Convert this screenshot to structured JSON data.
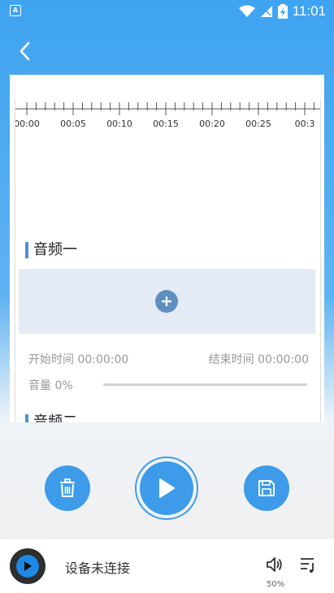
{
  "status_bar": {
    "left_icon": "A",
    "time": "11:01",
    "icons": [
      "wifi-icon",
      "signal-icon",
      "battery-icon"
    ]
  },
  "header": {
    "back_icon": "chevron-left-icon"
  },
  "timeline": {
    "labels": [
      "00:00",
      "00:05",
      "00:10",
      "00:15",
      "00:20",
      "00:25",
      "00:3"
    ]
  },
  "audio1": {
    "title": "音频一",
    "start_label": "开始时间 00:00:00",
    "end_label": "结束时间 00:00:00",
    "volume_label": "音量 0%",
    "volume_value": 0
  },
  "audio2": {
    "title": "音频二"
  },
  "controls": {
    "delete_icon": "trash-icon",
    "play_icon": "play-icon",
    "save_icon": "save-icon"
  },
  "player_bar": {
    "device_status": "设备未连接",
    "volume_percent": "50%",
    "volume_icon": "speaker-icon",
    "playlist_icon": "playlist-icon"
  },
  "colors": {
    "primary": "#3d9be9",
    "add_button": "#5e8fbf",
    "drop_area": "#e4ebf4",
    "section_accent": "#4a90d9"
  }
}
